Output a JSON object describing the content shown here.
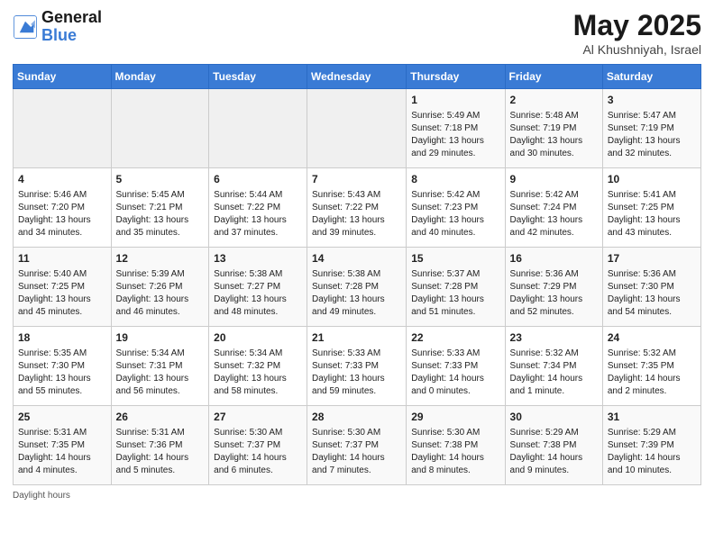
{
  "header": {
    "logo_line1": "General",
    "logo_line2": "Blue",
    "title": "May 2025",
    "subtitle": "Al Khushniyah, Israel"
  },
  "weekdays": [
    "Sunday",
    "Monday",
    "Tuesday",
    "Wednesday",
    "Thursday",
    "Friday",
    "Saturday"
  ],
  "weeks": [
    [
      {
        "day": "",
        "info": ""
      },
      {
        "day": "",
        "info": ""
      },
      {
        "day": "",
        "info": ""
      },
      {
        "day": "",
        "info": ""
      },
      {
        "day": "1",
        "info": "Sunrise: 5:49 AM\nSunset: 7:18 PM\nDaylight: 13 hours\nand 29 minutes."
      },
      {
        "day": "2",
        "info": "Sunrise: 5:48 AM\nSunset: 7:19 PM\nDaylight: 13 hours\nand 30 minutes."
      },
      {
        "day": "3",
        "info": "Sunrise: 5:47 AM\nSunset: 7:19 PM\nDaylight: 13 hours\nand 32 minutes."
      }
    ],
    [
      {
        "day": "4",
        "info": "Sunrise: 5:46 AM\nSunset: 7:20 PM\nDaylight: 13 hours\nand 34 minutes."
      },
      {
        "day": "5",
        "info": "Sunrise: 5:45 AM\nSunset: 7:21 PM\nDaylight: 13 hours\nand 35 minutes."
      },
      {
        "day": "6",
        "info": "Sunrise: 5:44 AM\nSunset: 7:22 PM\nDaylight: 13 hours\nand 37 minutes."
      },
      {
        "day": "7",
        "info": "Sunrise: 5:43 AM\nSunset: 7:22 PM\nDaylight: 13 hours\nand 39 minutes."
      },
      {
        "day": "8",
        "info": "Sunrise: 5:42 AM\nSunset: 7:23 PM\nDaylight: 13 hours\nand 40 minutes."
      },
      {
        "day": "9",
        "info": "Sunrise: 5:42 AM\nSunset: 7:24 PM\nDaylight: 13 hours\nand 42 minutes."
      },
      {
        "day": "10",
        "info": "Sunrise: 5:41 AM\nSunset: 7:25 PM\nDaylight: 13 hours\nand 43 minutes."
      }
    ],
    [
      {
        "day": "11",
        "info": "Sunrise: 5:40 AM\nSunset: 7:25 PM\nDaylight: 13 hours\nand 45 minutes."
      },
      {
        "day": "12",
        "info": "Sunrise: 5:39 AM\nSunset: 7:26 PM\nDaylight: 13 hours\nand 46 minutes."
      },
      {
        "day": "13",
        "info": "Sunrise: 5:38 AM\nSunset: 7:27 PM\nDaylight: 13 hours\nand 48 minutes."
      },
      {
        "day": "14",
        "info": "Sunrise: 5:38 AM\nSunset: 7:28 PM\nDaylight: 13 hours\nand 49 minutes."
      },
      {
        "day": "15",
        "info": "Sunrise: 5:37 AM\nSunset: 7:28 PM\nDaylight: 13 hours\nand 51 minutes."
      },
      {
        "day": "16",
        "info": "Sunrise: 5:36 AM\nSunset: 7:29 PM\nDaylight: 13 hours\nand 52 minutes."
      },
      {
        "day": "17",
        "info": "Sunrise: 5:36 AM\nSunset: 7:30 PM\nDaylight: 13 hours\nand 54 minutes."
      }
    ],
    [
      {
        "day": "18",
        "info": "Sunrise: 5:35 AM\nSunset: 7:30 PM\nDaylight: 13 hours\nand 55 minutes."
      },
      {
        "day": "19",
        "info": "Sunrise: 5:34 AM\nSunset: 7:31 PM\nDaylight: 13 hours\nand 56 minutes."
      },
      {
        "day": "20",
        "info": "Sunrise: 5:34 AM\nSunset: 7:32 PM\nDaylight: 13 hours\nand 58 minutes."
      },
      {
        "day": "21",
        "info": "Sunrise: 5:33 AM\nSunset: 7:33 PM\nDaylight: 13 hours\nand 59 minutes."
      },
      {
        "day": "22",
        "info": "Sunrise: 5:33 AM\nSunset: 7:33 PM\nDaylight: 14 hours\nand 0 minutes."
      },
      {
        "day": "23",
        "info": "Sunrise: 5:32 AM\nSunset: 7:34 PM\nDaylight: 14 hours\nand 1 minute."
      },
      {
        "day": "24",
        "info": "Sunrise: 5:32 AM\nSunset: 7:35 PM\nDaylight: 14 hours\nand 2 minutes."
      }
    ],
    [
      {
        "day": "25",
        "info": "Sunrise: 5:31 AM\nSunset: 7:35 PM\nDaylight: 14 hours\nand 4 minutes."
      },
      {
        "day": "26",
        "info": "Sunrise: 5:31 AM\nSunset: 7:36 PM\nDaylight: 14 hours\nand 5 minutes."
      },
      {
        "day": "27",
        "info": "Sunrise: 5:30 AM\nSunset: 7:37 PM\nDaylight: 14 hours\nand 6 minutes."
      },
      {
        "day": "28",
        "info": "Sunrise: 5:30 AM\nSunset: 7:37 PM\nDaylight: 14 hours\nand 7 minutes."
      },
      {
        "day": "29",
        "info": "Sunrise: 5:30 AM\nSunset: 7:38 PM\nDaylight: 14 hours\nand 8 minutes."
      },
      {
        "day": "30",
        "info": "Sunrise: 5:29 AM\nSunset: 7:38 PM\nDaylight: 14 hours\nand 9 minutes."
      },
      {
        "day": "31",
        "info": "Sunrise: 5:29 AM\nSunset: 7:39 PM\nDaylight: 14 hours\nand 10 minutes."
      }
    ]
  ],
  "footer": {
    "daylight_label": "Daylight hours"
  },
  "colors": {
    "header_bg": "#3a7bd5",
    "logo_blue": "#3a7bd5"
  }
}
